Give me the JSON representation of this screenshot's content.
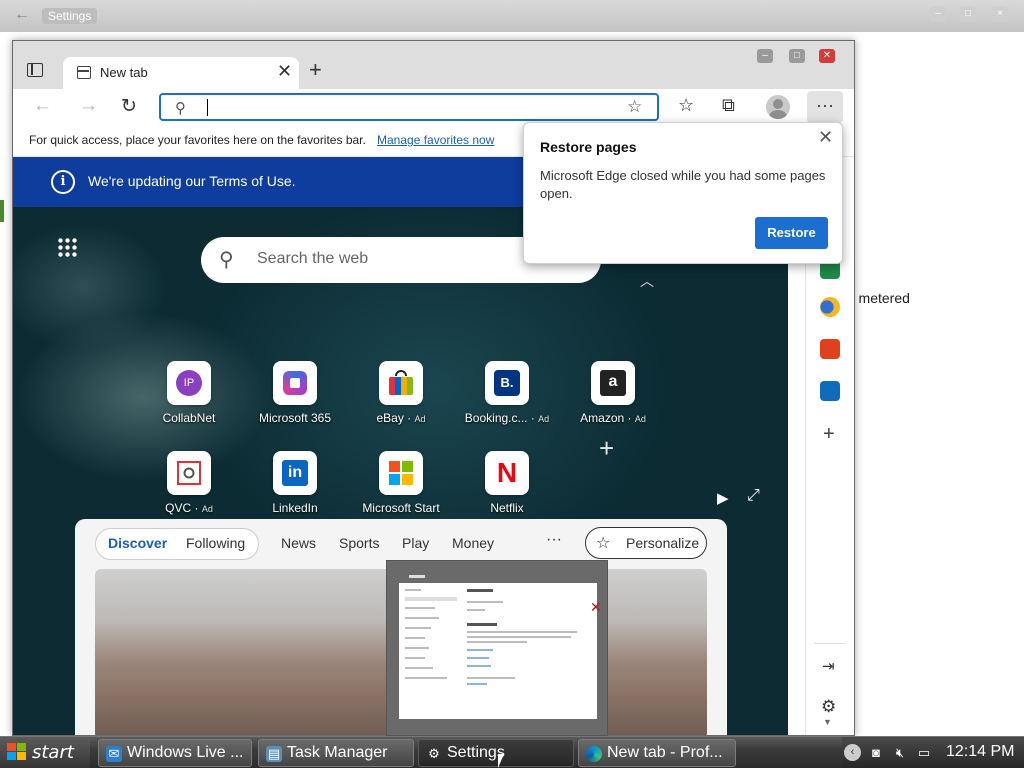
{
  "background_window": {
    "title": "Settings",
    "partial_text": "r metered"
  },
  "edge": {
    "tab": {
      "label": "New tab"
    },
    "favorites_bar": {
      "message": "For quick access, place your favorites here on the favorites bar.",
      "link": "Manage favorites now"
    },
    "terms_banner": {
      "text": "We're updating our Terms of Use."
    },
    "search": {
      "placeholder": "Search the web"
    },
    "tiles": [
      {
        "label": "CollabNet",
        "ad": "",
        "icon": "ip-icon"
      },
      {
        "label": "Microsoft 365",
        "ad": "",
        "icon": "microsoft-365-icon"
      },
      {
        "label": "eBay",
        "ad": "Ad",
        "icon": "ebay-icon"
      },
      {
        "label": "Booking.c...",
        "ad": "Ad",
        "icon": "booking-icon"
      },
      {
        "label": "Amazon",
        "ad": "Ad",
        "icon": "amazon-icon"
      },
      {
        "label": "QVC",
        "ad": "Ad",
        "icon": "qvc-icon"
      },
      {
        "label": "LinkedIn",
        "ad": "",
        "icon": "linkedin-icon"
      },
      {
        "label": "Microsoft Start",
        "ad": "",
        "icon": "microsoft-start-icon"
      },
      {
        "label": "Netflix",
        "ad": "",
        "icon": "netflix-icon"
      }
    ],
    "tile_icons": {
      "collabnet": "IP",
      "booking": "B.",
      "linkedin": "in",
      "netflix": "N",
      "amazon": "a"
    },
    "feed": {
      "tabs": [
        "Discover",
        "Following",
        "News",
        "Sports",
        "Play",
        "Money"
      ],
      "more": "···",
      "personalize": "Personalize"
    },
    "restore_popup": {
      "title": "Restore pages",
      "message": "Microsoft Edge closed while you had some pages open.",
      "button": "Restore"
    }
  },
  "taskbar": {
    "start": "start",
    "items": [
      {
        "label": "Windows Live ...",
        "icon": "windows-live-icon"
      },
      {
        "label": "Task Manager",
        "icon": "task-manager-icon"
      },
      {
        "label": "Settings",
        "icon": "gear-icon"
      },
      {
        "label": "New tab - Prof...",
        "icon": "edge-icon"
      }
    ],
    "clock": "12:14 PM"
  },
  "colors": {
    "accent": "#1a6fd0",
    "terms_banner": "#0e3d9e",
    "close_red": "#d63a3a"
  }
}
